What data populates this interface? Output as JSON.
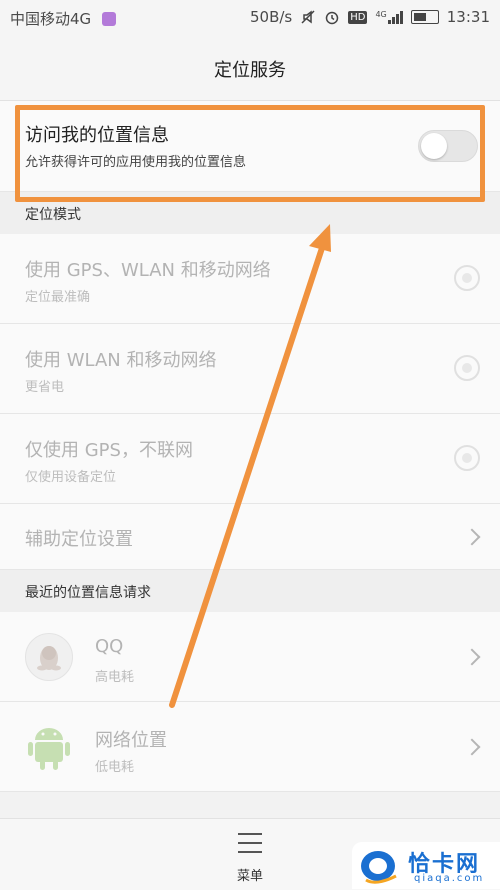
{
  "status_bar": {
    "carrier": "中国移动4G",
    "speed": "50B/s",
    "hd": "HD",
    "net": "4G",
    "time": "13:31"
  },
  "header": {
    "title": "定位服务"
  },
  "location_access": {
    "title": "访问我的位置信息",
    "subtitle": "允许获得许可的应用使用我的位置信息",
    "enabled": false
  },
  "location_mode": {
    "section_title": "定位模式",
    "options": [
      {
        "title": "使用 GPS、WLAN 和移动网络",
        "subtitle": "定位最准确"
      },
      {
        "title": "使用 WLAN 和移动网络",
        "subtitle": "更省电"
      },
      {
        "title": "仅使用 GPS，不联网",
        "subtitle": "仅使用设备定位"
      }
    ],
    "assist": "辅助定位设置"
  },
  "recent_requests": {
    "section_title": "最近的位置信息请求",
    "apps": [
      {
        "name": "QQ",
        "usage": "高电耗",
        "icon": "qq-penguin-icon"
      },
      {
        "name": "网络位置",
        "usage": "低电耗",
        "icon": "android-icon"
      }
    ]
  },
  "bottom_bar": {
    "menu_label": "菜单"
  },
  "watermark": {
    "text": "恰卡网",
    "url": "qiaqa.com"
  },
  "colors": {
    "highlight": "#f0923e",
    "arrow": "#f0923e",
    "text": "#222222",
    "dim_text": "#b3b3b3"
  }
}
